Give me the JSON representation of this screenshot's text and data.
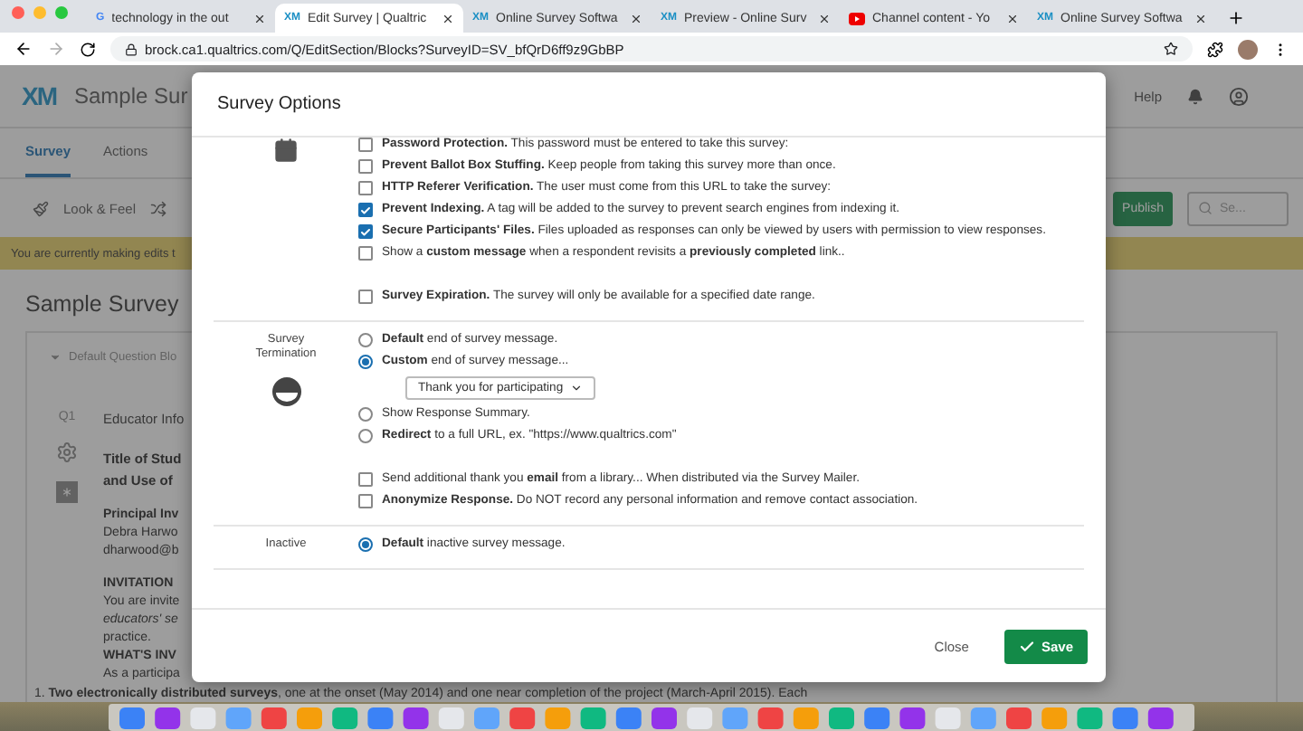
{
  "browser": {
    "tabs": [
      {
        "title": "technology in the out",
        "kind": "letters",
        "mark": "G",
        "selected": false
      },
      {
        "title": "Edit Survey | Qualtric",
        "kind": "letters",
        "mark": "XM",
        "selected": true
      },
      {
        "title": "Online Survey Softwa",
        "kind": "letters",
        "mark": "XM",
        "selected": false
      },
      {
        "title": "Preview - Online Surv",
        "kind": "letters",
        "mark": "XM",
        "selected": false
      },
      {
        "title": "Channel content - Yo",
        "kind": "video",
        "selected": false
      },
      {
        "title": "Online Survey Softwa",
        "kind": "letters",
        "mark": "XM",
        "selected": false
      }
    ],
    "url": "brock.ca1.qualtrics.com/Q/EditSection/Blocks?SurveyID=SV_bfQrD6ff9z9GbBP"
  },
  "app": {
    "logo": "XM",
    "title": "Sample Sur",
    "help": "Help",
    "nav": [
      {
        "label": "Survey",
        "selected": true
      },
      {
        "label": "Actions",
        "selected": false
      }
    ],
    "toolbar": "Look & Feel",
    "publish": "Publish",
    "search": {
      "placeholder": "Se..."
    },
    "banner": "You are currently making edits t",
    "heading": "Sample Survey",
    "block": "Default Question Blo",
    "question": {
      "number": "Q1",
      "title": "Educator Info"
    },
    "body": [
      {
        "text": "Title of Stud",
        "kind": "strong"
      },
      {
        "text": "and Use of",
        "kind": "strong"
      },
      {
        "text": "Principal Inv",
        "kind": "bold"
      },
      {
        "text": "Debra Harwo",
        "kind": "plain"
      },
      {
        "text": "dharwood@b",
        "kind": "plain"
      },
      {
        "text": "INVITATION",
        "kind": "bold"
      },
      {
        "text": "You are invite",
        "kind": "plain"
      },
      {
        "text": "educators' se",
        "kind": "italic"
      },
      {
        "text": "practice.",
        "kind": "plain"
      },
      {
        "text": "WHAT'S INV",
        "kind": "bold"
      },
      {
        "text": "As a participa",
        "kind": "plain"
      }
    ],
    "footline": "1. **Two electronically distributed surveys**, one at the onset (May 2014) and one near completion of the project (March-April 2015). Each"
  },
  "modal": {
    "title": "Survey Options",
    "sections": [
      {
        "options": [
          {
            "kind": "checkbox",
            "text": "**Password Protection.** This password must be entered to take this survey:",
            "checked": false
          },
          {
            "kind": "checkbox",
            "text": "**Prevent Ballot Box Stuffing.** Keep people from taking this survey more than once.",
            "checked": false
          },
          {
            "kind": "checkbox",
            "text": "**HTTP Referer Verification.** The user must come from this URL to take the survey:",
            "checked": false
          },
          {
            "kind": "checkbox",
            "text": "**Prevent Indexing.** A tag will be added to the survey to prevent search engines from indexing it.",
            "checked": true
          },
          {
            "kind": "checkbox",
            "text": "**Secure Participants' Files.** Files uploaded as responses can only be viewed by users with permission to view responses.",
            "checked": true
          },
          {
            "kind": "checkbox",
            "text": "Show a **custom message** when a respondent revisits a **previously completed** link..",
            "checked": false
          },
          {
            "kind": "spacer"
          },
          {
            "kind": "checkbox",
            "text": "**Survey Expiration.** The survey will only be available for a specified date range.",
            "checked": false
          }
        ]
      },
      {
        "label": "Survey Termination",
        "options": [
          {
            "kind": "radio",
            "text": "**Default** end of survey message.",
            "selected": false
          },
          {
            "kind": "radio",
            "text": "**Custom** end of survey message...",
            "selected": true
          },
          {
            "kind": "dropdown",
            "value": "Thank you for participating"
          },
          {
            "kind": "radio",
            "text": "Show Response Summary.",
            "selected": false
          },
          {
            "kind": "radio",
            "text": "**Redirect** to a full URL, ex. \"https://www.qualtrics.com\"",
            "selected": false
          },
          {
            "kind": "spacer"
          },
          {
            "kind": "checkbox",
            "text": "Send additional thank you **email** from a library... When distributed via the Survey Mailer.",
            "checked": false
          },
          {
            "kind": "checkbox",
            "text": "**Anonymize Response.** Do NOT record any personal information and remove contact association.",
            "checked": false
          }
        ]
      },
      {
        "label": "Inactive",
        "options": [
          {
            "kind": "radio",
            "text": "**Default** inactive survey message.",
            "selected": true
          }
        ]
      }
    ],
    "close": "Close",
    "save": "Save"
  }
}
